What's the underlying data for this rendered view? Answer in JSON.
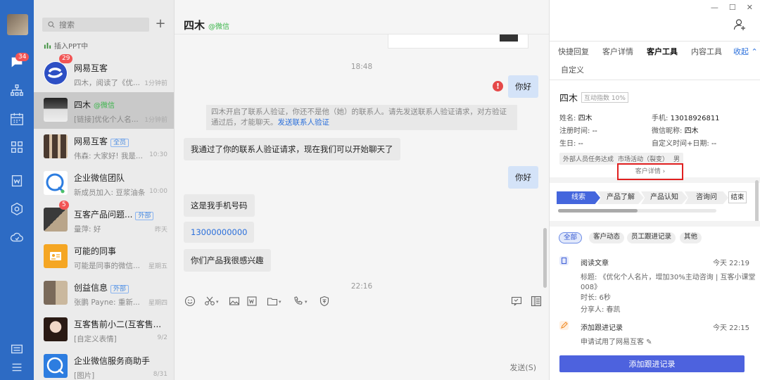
{
  "search": {
    "placeholder": "搜索"
  },
  "nav": {
    "badge": "34"
  },
  "ppt_row": {
    "label": "插入PPT中"
  },
  "conversations": [
    {
      "name": "网易互客",
      "tag": "",
      "preview": "四木，阅读了《优...",
      "time": "1分钟前",
      "badge": "29"
    },
    {
      "name": "四木",
      "tag": "@微信",
      "preview": "[链接]优化个人名...",
      "time": "1分钟前",
      "badge": ""
    },
    {
      "name": "网易互客",
      "tag": "全员",
      "preview": "伟森: 大家好! 我是...",
      "time": "10:30",
      "badge": ""
    },
    {
      "name": "企业微信团队",
      "tag": "",
      "preview": "新成员加入: 豆浆油条",
      "time": "10:00",
      "badge": ""
    },
    {
      "name": "互客产品问题...",
      "tag": "外部",
      "preview": "量萍: 好",
      "time": "昨天",
      "badge": "5"
    },
    {
      "name": "可能的同事",
      "tag": "",
      "preview": "可能是同事的微信...",
      "time": "星期五",
      "badge": ""
    },
    {
      "name": "创益信息",
      "tag": "外部",
      "preview": "张鹏 Payne: 重新...",
      "time": "星期四",
      "badge": ""
    },
    {
      "name": "互客售前小二(互客售...",
      "tag": "",
      "preview": "[自定义表情]",
      "time": "9/2",
      "badge": ""
    },
    {
      "name": "企业微信服务商助手",
      "tag": "",
      "preview": "[图片]",
      "time": "8/31",
      "badge": ""
    }
  ],
  "chat": {
    "title": "四木",
    "subtitle": "@微信",
    "time1": "18:48",
    "time2": "22:16",
    "msg_hello1": "你好",
    "sysnote_text": "四木开启了联系人验证，你还不是他（她）的联系人。请先发送联系人验证请求，对方验证通过后，才能聊天。",
    "sysnote_link": "发送联系人验证",
    "msg_passed": "我通过了你的联系人验证请求，现在我们可以开始聊天了",
    "msg_hello2": "你好",
    "msg_phone_label": "这是我手机号码",
    "msg_phone": "13000000000",
    "msg_interest": "你们产品我很感兴趣",
    "warn": "!",
    "send_label": "发送(S)"
  },
  "window": {
    "min": "—",
    "max": "☐",
    "close": "✕"
  },
  "rpanel": {
    "tabs": [
      "快捷回复",
      "客户详情",
      "客户工具",
      "内容工具",
      "收起 ⌃",
      "自定义"
    ],
    "customer": {
      "name": "四木",
      "score": "互动指数 10%",
      "name_label": "姓名:",
      "name_value": "四木",
      "phone_label": "手机:",
      "phone_value": "13018926811",
      "reg_label": "注册时间:",
      "reg_value": "--",
      "nick_label": "微信昵称:",
      "nick_value": "四木",
      "bday_label": "生日:",
      "bday_value": "--",
      "custom_label": "自定义时间+日期:",
      "custom_value": "--",
      "chips": [
        "外部人员任务达成",
        "市场活动（裂变）",
        "男"
      ],
      "detail_link": "客户详情 ›"
    },
    "stages": [
      "线索",
      "产品了解",
      "产品认知",
      "咨询问",
      "结束"
    ],
    "progress": 0.5,
    "filters": [
      "全部",
      "客户动态",
      "员工跟进记录",
      "其他"
    ],
    "events": [
      {
        "title": "阅读文章",
        "time": "今天 22:19",
        "line1": "标题: 《优化个人名片，增加30%主动咨询 | 互客小课堂",
        "line2": "008》",
        "line3": "时长: 6秒",
        "line4": "分享人: 春凯"
      },
      {
        "title": "添加跟进记录",
        "time": "今天 22:15",
        "line1": "申请试用了网易互客 ✎"
      }
    ],
    "add_button": "添加跟进记录"
  }
}
